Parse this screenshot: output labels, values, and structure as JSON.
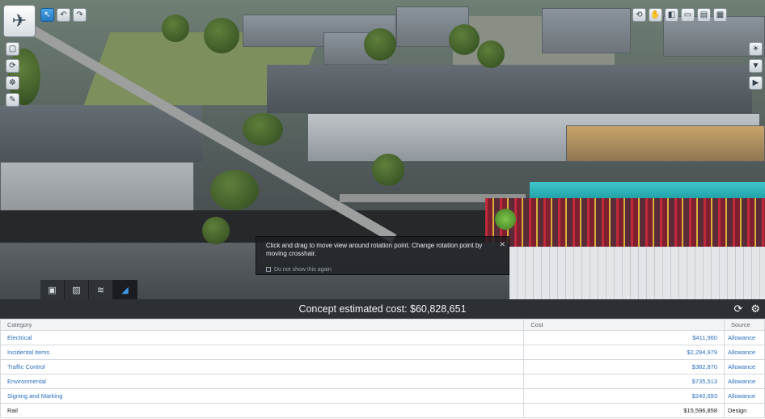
{
  "viewport": {
    "tooltip": {
      "text": "Click and drag to move view around rotation point. Change rotation point by moving crosshair.",
      "hint": "Do not show this again"
    },
    "top_left_tools": [
      "logo-icon",
      "select-icon",
      "undo-icon",
      "redo-icon"
    ],
    "left_tools": [
      "clip-icon",
      "rotate-icon",
      "pan-icon",
      "draw-icon"
    ],
    "top_right_tools": [
      "orbit-icon",
      "hand-icon",
      "split-view-icon",
      "window-icon",
      "layout-icon",
      "grid-icon"
    ],
    "right_tools": [
      "sun-icon",
      "compass-icon",
      "video-icon"
    ],
    "bottom_tabs": [
      "monitor-icon",
      "image-icon",
      "layers-icon",
      "cost-icon"
    ]
  },
  "panel": {
    "title": "Concept estimated cost: $60,828,651",
    "columns": [
      "Category",
      "Cost",
      "Source"
    ],
    "rows": [
      {
        "category": "Electrical",
        "cost": "$411,960",
        "source": "Allowance",
        "link": true
      },
      {
        "category": "Incidental items",
        "cost": "$2,294,979",
        "source": "Allowance",
        "link": true
      },
      {
        "category": "Traffic Control",
        "cost": "$382,870",
        "source": "Allowance",
        "link": true
      },
      {
        "category": "Environmental",
        "cost": "$735,513",
        "source": "Allowance",
        "link": true
      },
      {
        "category": "Signing and Marking",
        "cost": "$240,693",
        "source": "Allowance",
        "link": true
      },
      {
        "category": "Rail",
        "cost": "$15,596,858",
        "source": "Design",
        "link": false
      }
    ]
  }
}
